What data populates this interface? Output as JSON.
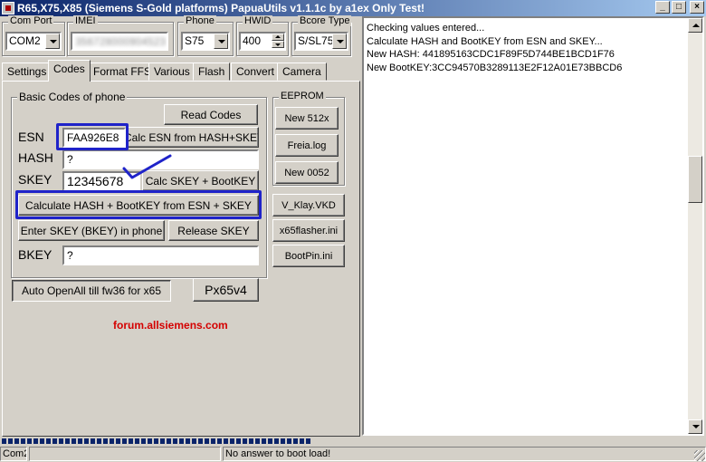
{
  "window": {
    "title": "R65,X75,X85 (Siemens S-Gold platforms) PapuaUtils v1.1.1c by a1ex Only Test!",
    "minimize": "_",
    "maximize": "□",
    "close": "×"
  },
  "top": {
    "com_port_label": "Com Port",
    "com_port_value": "COM2",
    "imei_label": "IMEI",
    "imei_value": "356728000904523",
    "phone_label": "Phone",
    "phone_value": "S75",
    "hwid_label": "HWID",
    "hwid_value": "400",
    "bcore_label": "Bcore Type",
    "bcore_value": "S/SL75"
  },
  "tabs": [
    "Settings",
    "Codes",
    "Format FFS",
    "Various",
    "Flash",
    "Convert",
    "Camera"
  ],
  "codes": {
    "group_label": "Basic Codes of phone",
    "read_codes": "Read Codes",
    "esn_label": "ESN",
    "esn_value": "FAA926E8",
    "calc_esn": "Calc ESN from HASH+SKEY",
    "hash_label": "HASH",
    "hash_value": "?",
    "skey_label": "SKEY",
    "skey_value": "12345678",
    "calc_skey": "Calc SKEY + BootKEY",
    "calc_hash": "Calculate HASH + BootKEY from ESN + SKEY",
    "enter_skey": "Enter SKEY (BKEY) in phone",
    "release_skey": "Release SKEY",
    "bkey_label": "BKEY",
    "bkey_value": "?",
    "auto_open": "Auto OpenAll till fw36 for x65",
    "px65": "Px65v4",
    "forum": "forum.allsiemens.com"
  },
  "eeprom": {
    "label": "EEPROM",
    "buttons": [
      "New 512x",
      "Freia.log",
      "New 0052"
    ]
  },
  "side_buttons": [
    "V_Klay.VKD",
    "x65flasher.ini",
    "BootPin.ini"
  ],
  "log": [
    "Checking values entered...",
    "Calculate HASH and BootKEY from ESN and SKEY...",
    "New HASH: 441895163CDC1F89F5D744BE1BCD1F76",
    "New BootKEY:3CC94570B3289113E2F12A01E73BBCD6"
  ],
  "status": {
    "port": "Com2",
    "middle": "",
    "message": "No answer to boot load!"
  },
  "colors": {
    "highlight": "#1f23c9",
    "forum": "#d40000",
    "title_start": "#0a246a",
    "title_end": "#a6caf0",
    "face": "#d4d0c8"
  }
}
